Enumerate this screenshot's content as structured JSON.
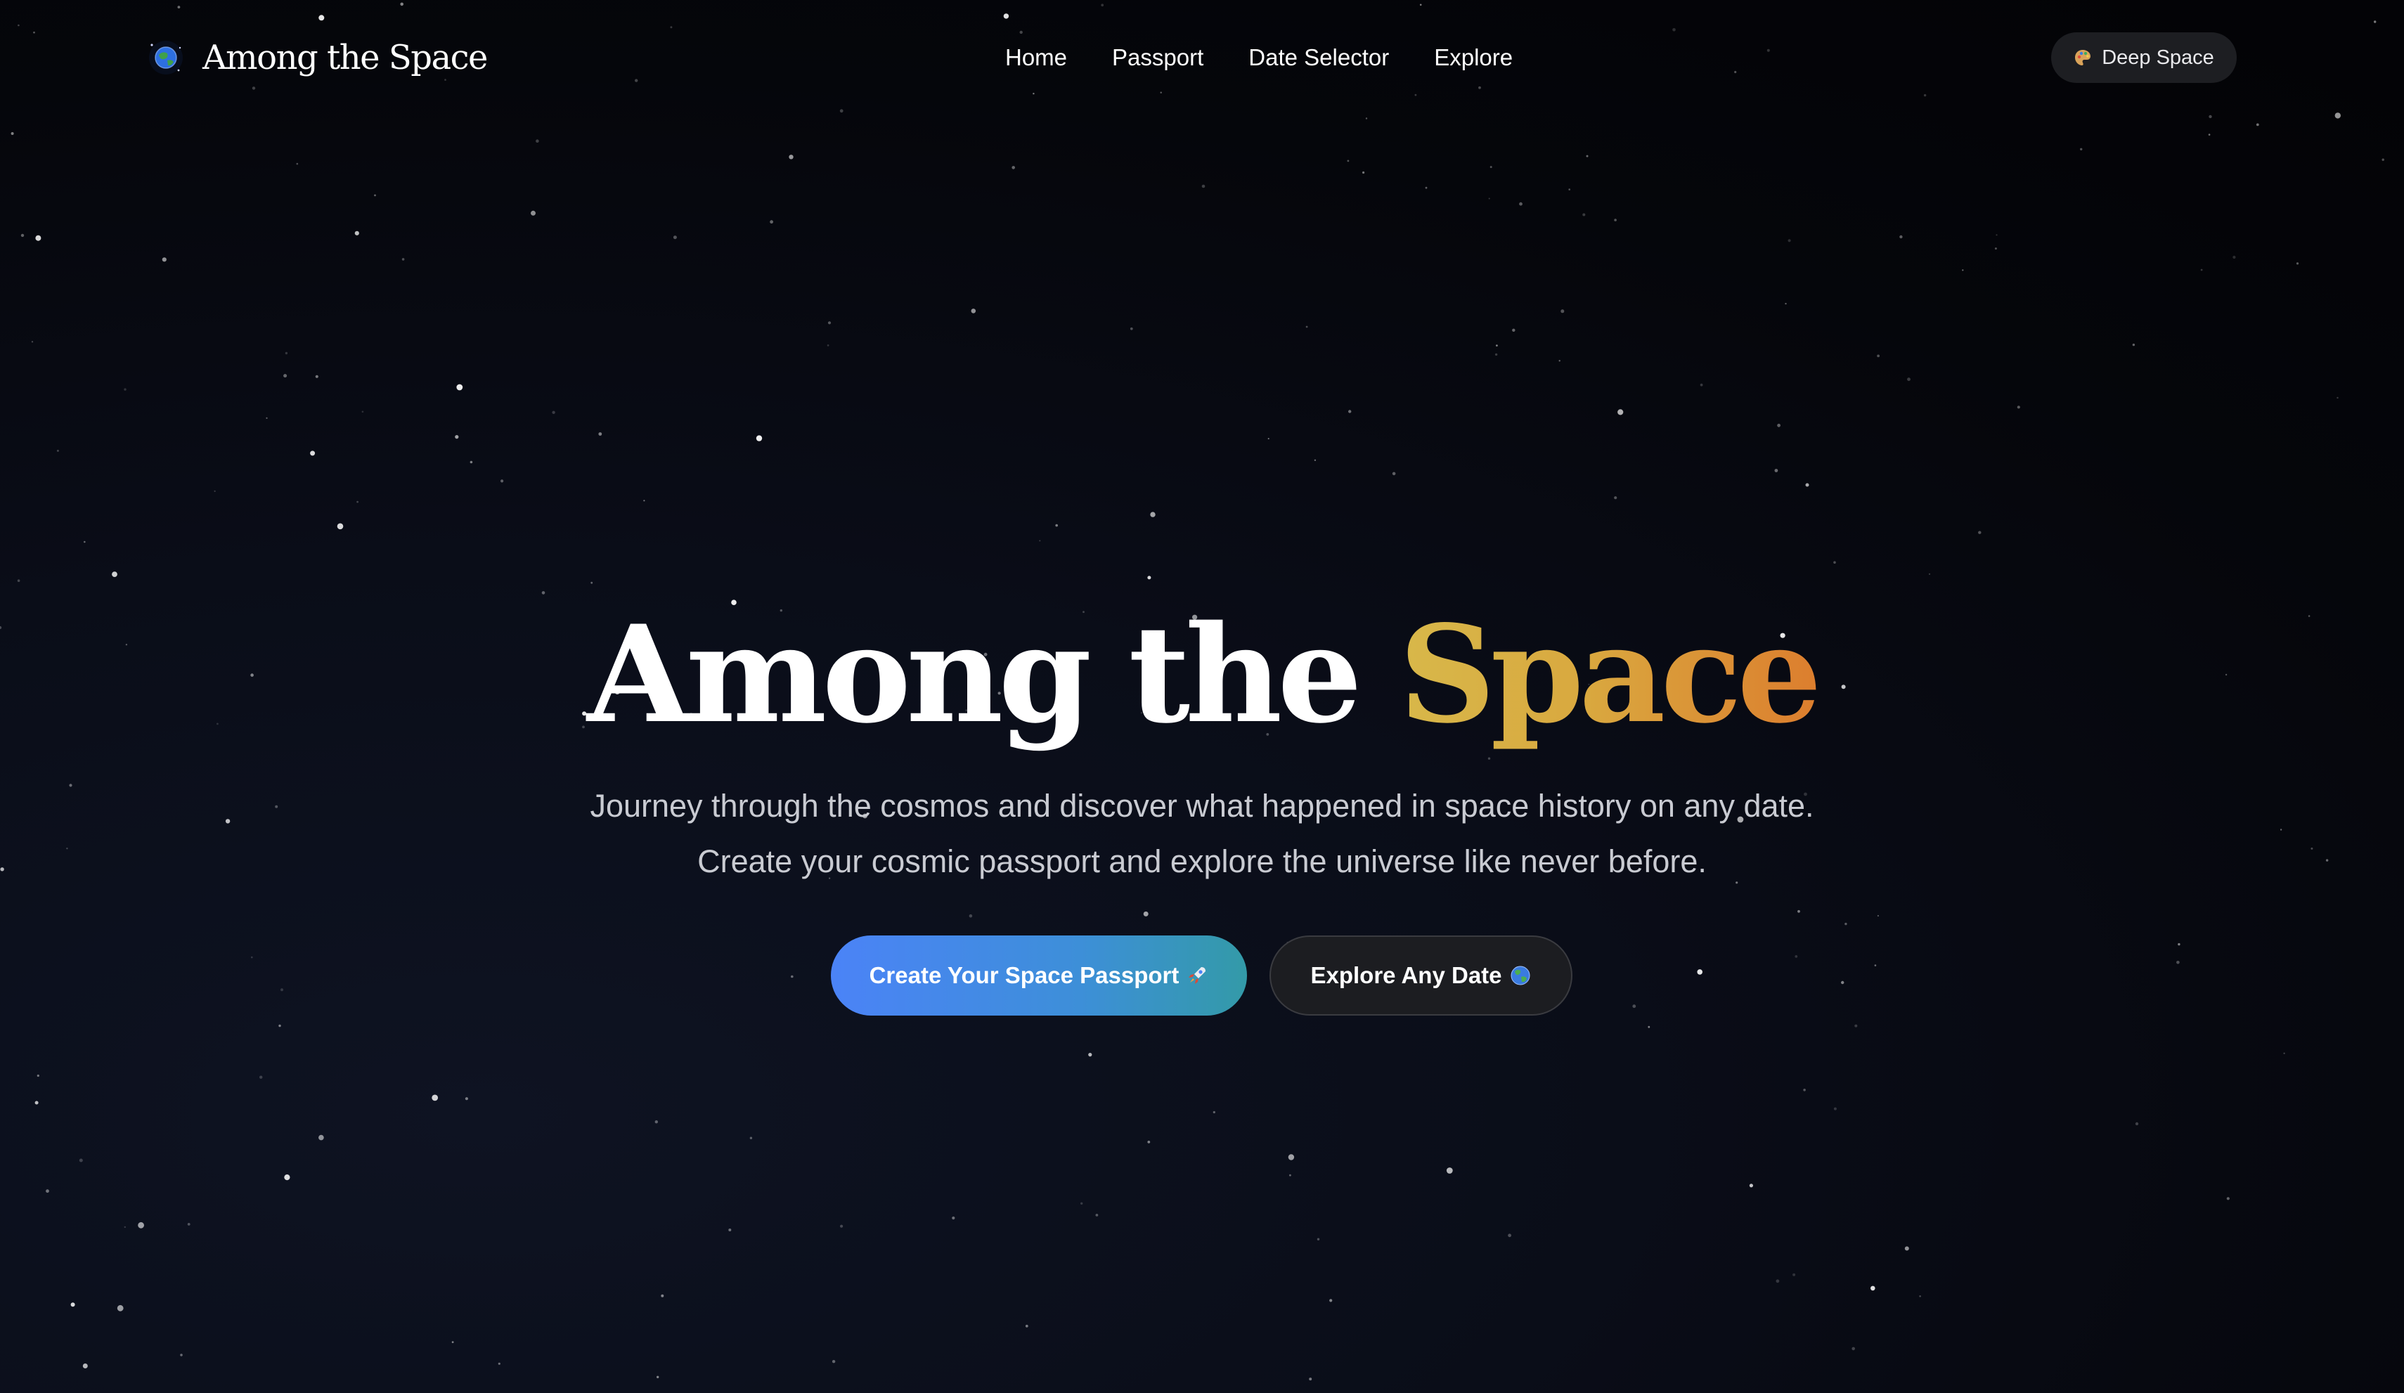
{
  "nav": {
    "brand_name": "Among the Space",
    "links": [
      "Home",
      "Passport",
      "Date Selector",
      "Explore"
    ],
    "theme_label": "Deep Space",
    "theme_icon": "palette-icon"
  },
  "hero": {
    "title_white": "Among the",
    "title_gold": "Space",
    "subtitle_line1": "Journey through the cosmos and discover what happened in space history on any date.",
    "subtitle_line2": "Create your cosmic passport and explore the universe like never before.",
    "primary_button": "Create Your Space Passport",
    "primary_button_icon": "rocket-icon",
    "secondary_button": "Explore Any Date",
    "secondary_button_icon": "globe-icon"
  },
  "colors": {
    "background": "#05060b",
    "accent_gold": "#d8b84a",
    "accent_orange": "#dc7e2e",
    "primary_blue": "#4b83f7",
    "primary_teal": "#339aa8"
  }
}
